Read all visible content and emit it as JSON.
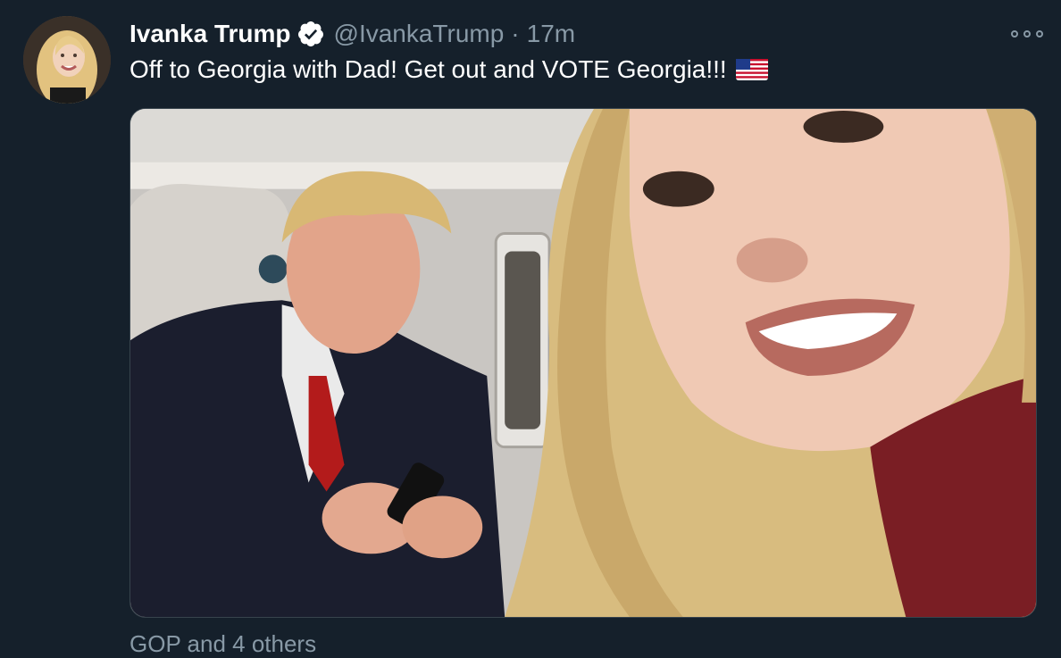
{
  "tweet": {
    "author_name": "Ivanka Trump",
    "author_handle": "@IvankaTrump",
    "separator": "·",
    "time": "17m",
    "text": "Off to Georgia with Dad! Get out and VOTE Georgia!!!",
    "emoji": "us-flag-emoji",
    "verified_icon": "verified-badge-icon",
    "more_icon": "more-options-icon",
    "media_description_icon": "photo",
    "footer": "GOP and 4 others"
  },
  "colors": {
    "background": "#15202b",
    "secondary_text": "#8899a6",
    "verified": "#ffffff",
    "border": "#38444d"
  }
}
